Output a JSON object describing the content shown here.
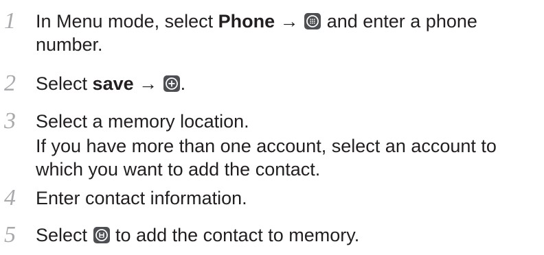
{
  "steps": [
    {
      "number": "1",
      "text_before": "In Menu mode, select ",
      "bold": "Phone",
      "arrow": "→",
      "icon": "keypad-icon",
      "text_after": " and enter a phone",
      "continuation": "number."
    },
    {
      "number": "2",
      "text_before": "Select ",
      "bold": "save",
      "arrow": "→",
      "icon": "add-icon",
      "text_after": "."
    },
    {
      "number": "3",
      "text": "Select a memory location.",
      "note_line1": "If you have more than one account, select an account to",
      "note_line2": "which you want to add the contact."
    },
    {
      "number": "4",
      "text": "Enter contact information."
    },
    {
      "number": "5",
      "text_before": "Select ",
      "icon": "save-icon",
      "text_after": " to add the contact to memory."
    }
  ]
}
